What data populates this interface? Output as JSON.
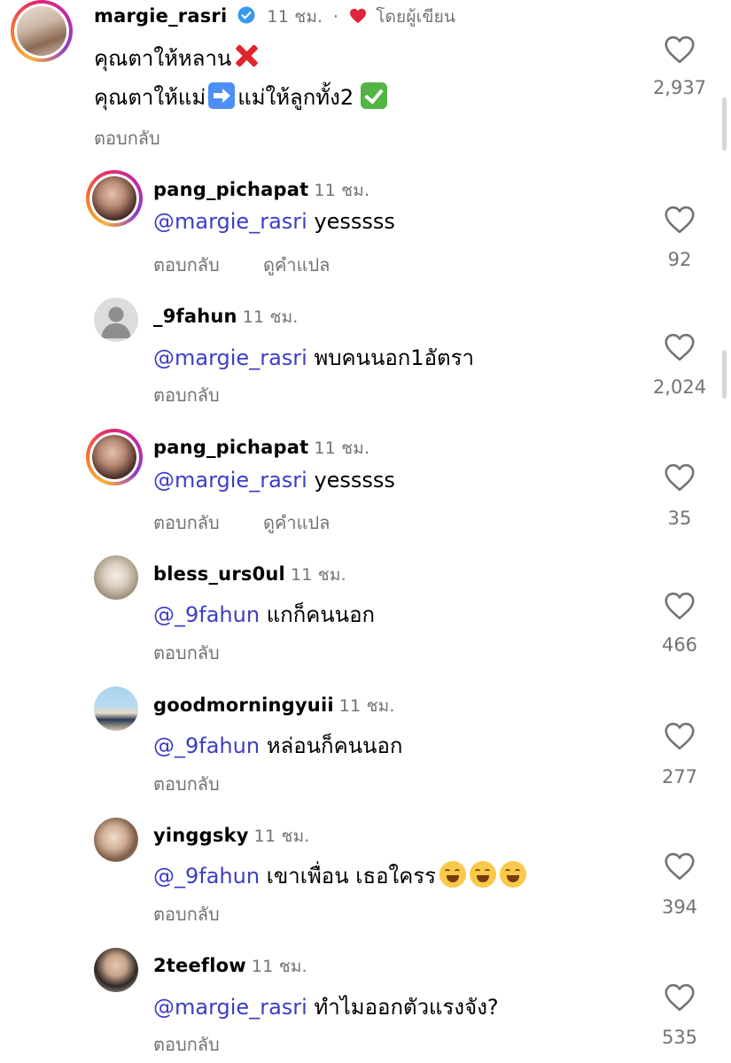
{
  "reply_label": "ตอบกลับ",
  "translate_label": "ดูคำแปล",
  "main_comment": {
    "username": "margie_rasri",
    "time": "11 ชม.",
    "author_badge": "โดยผู้เขียน",
    "line1": "คุณตาให้หลาน",
    "line2_a": "คุณตาให้แม่",
    "line2_b": "แม่ให้ลูกทั้ง2",
    "likes": "2,937",
    "reply": "ตอบกลับ"
  },
  "replies": [
    {
      "username": "pang_pichapat",
      "time": "11 ชม.",
      "mention": "@margie_rasri",
      "text": " yesssss",
      "likes": "92",
      "reply": "ตอบกลับ",
      "translate": "ดูคำแปล"
    },
    {
      "username": "_9fahun",
      "time": "11 ชม.",
      "mention": "@margie_rasri",
      "text": " พบคนนอก1อัตรา",
      "likes": "2,024",
      "reply": "ตอบกลับ"
    },
    {
      "username": "pang_pichapat",
      "time": "11 ชม.",
      "mention": "@margie_rasri",
      "text": " yesssss",
      "likes": "35",
      "reply": "ตอบกลับ",
      "translate": "ดูคำแปล"
    },
    {
      "username": "bless_urs0ul",
      "time": "11 ชม.",
      "mention": "@_9fahun",
      "text": " แกก็คนนอก",
      "likes": "466",
      "reply": "ตอบกลับ"
    },
    {
      "username": "goodmorningyuii",
      "time": "11 ชม.",
      "mention": "@_9fahun",
      "text": " หล่อนก็คนนอก",
      "likes": "277",
      "reply": "ตอบกลับ"
    },
    {
      "username": "yinggsky",
      "time": "11 ชม.",
      "mention": "@_9fahun",
      "text": " เขาเพื่อน เธอใครร",
      "likes": "394",
      "reply": "ตอบกลับ"
    },
    {
      "username": "2teeflow",
      "time": "11 ชม.",
      "mention": "@margie_rasri",
      "text": " ทำไมออกตัวแรงจัง?",
      "likes": "535",
      "reply": "ตอบกลับ"
    }
  ],
  "colors": {
    "mention": "#3c3ec6",
    "secondary_text": "#737373",
    "heart_badge": "#e0243a",
    "verified": "#3897f0"
  }
}
